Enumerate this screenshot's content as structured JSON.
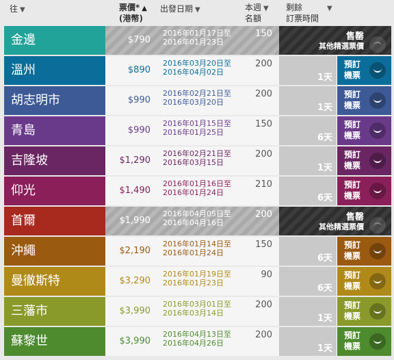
{
  "header": {
    "to_label": "往",
    "price_label_1": "票價*",
    "price_label_2": "(港幣)",
    "date_label": "出發日期",
    "seats_label_1": "本週",
    "seats_label_2": "名額",
    "remaining_label_1": "剩餘",
    "remaining_label_2": "訂票時間"
  },
  "book_label_1": "預訂",
  "book_label_2": "機票",
  "sold_title": "售罄",
  "sold_sub": "其他精選票價",
  "rows": [
    {
      "city": "金邊",
      "price": "$790",
      "date_from": "2016年01月17日至",
      "date_to": "2016年01月23日",
      "seats": "150",
      "status": "sold",
      "color": "#21a39a"
    },
    {
      "city": "溫州",
      "price": "$890",
      "date_from": "2016年03月20日至",
      "date_to": "2016年04月02日",
      "seats": "200",
      "days": "1天",
      "status": "book",
      "color": "#0b6e9a"
    },
    {
      "city": "胡志明市",
      "price": "$990",
      "date_from": "2016年02月21日至",
      "date_to": "2016年03月20日",
      "seats": "200",
      "days": "1天",
      "status": "book",
      "color": "#3d5a96"
    },
    {
      "city": "青島",
      "price": "$990",
      "date_from": "2016年01月15日至",
      "date_to": "2016年01月25日",
      "seats": "150",
      "days": "6天",
      "status": "book",
      "color": "#6a3a8a"
    },
    {
      "city": "吉隆坡",
      "price": "$1,290",
      "date_from": "2016年02月21日至",
      "date_to": "2016年03月15日",
      "seats": "200",
      "days": "1天",
      "status": "book",
      "color": "#6a2662"
    },
    {
      "city": "仰光",
      "price": "$1,490",
      "date_from": "2016年01月16日至",
      "date_to": "2016年01月24日",
      "seats": "210",
      "days": "6天",
      "status": "book",
      "color": "#8a1f5a"
    },
    {
      "city": "首爾",
      "price": "$1,990",
      "date_from": "2016年04月05日至",
      "date_to": "2016年04月16日",
      "seats": "200",
      "status": "sold",
      "color": "#a8291e"
    },
    {
      "city": "沖繩",
      "price": "$2,190",
      "date_from": "2016年01月14日至",
      "date_to": "2016年01月24日",
      "seats": "150",
      "days": "6天",
      "status": "book",
      "color": "#9a5a10"
    },
    {
      "city": "曼徹斯特",
      "price": "$3,290",
      "date_from": "2016年01月19日至",
      "date_to": "2016年01月23日",
      "seats": "90",
      "days": "6天",
      "status": "book",
      "color": "#b08a18"
    },
    {
      "city": "三藩市",
      "price": "$3,990",
      "date_from": "2016年03月01日至",
      "date_to": "2016年03月14日",
      "seats": "200",
      "days": "1天",
      "status": "book",
      "color": "#8a9a2a"
    },
    {
      "city": "蘇黎世",
      "price": "$3,990",
      "date_from": "2016年04月13日至",
      "date_to": "2016年04月26日",
      "seats": "200",
      "days": "1天",
      "status": "book",
      "color": "#4e8a2e"
    }
  ]
}
